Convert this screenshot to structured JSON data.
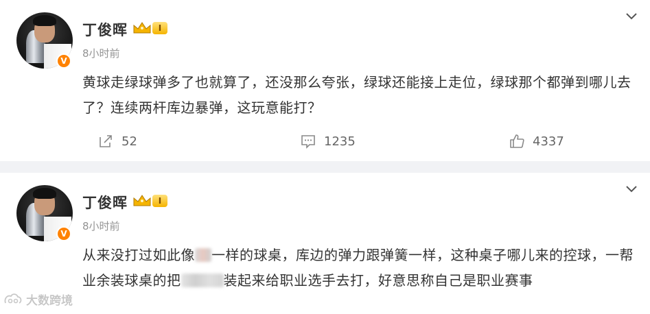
{
  "posts": [
    {
      "username": "丁俊晖",
      "level": "I",
      "verified": "V",
      "time": "8小时前",
      "content": "黄球走绿球弹多了也就算了，还没那么夸张，绿球还能接上走位，绿球那个都弹到哪儿去了？连续两杆库边暴弹，这玩意能打？",
      "actions": {
        "repost_count": "52",
        "comment_count": "1235",
        "like_count": "4337"
      }
    },
    {
      "username": "丁俊晖",
      "level": "I",
      "verified": "V",
      "time": "8小时前",
      "content_part1": "从来没打过如此像",
      "content_part2": "一样的球桌，库边的弹力跟弹簧一样，这种桌子哪儿来的控球，一帮业余装球桌的把",
      "content_part3": "装起来给职业选手去打，好意思称自己是职业赛事"
    }
  ],
  "watermark": {
    "text": "大数跨境"
  },
  "colors": {
    "accent_orange": "#ff8200",
    "gold": "#f5b400",
    "text": "#333333",
    "muted": "#939393",
    "separator": "#f1f2f5"
  }
}
